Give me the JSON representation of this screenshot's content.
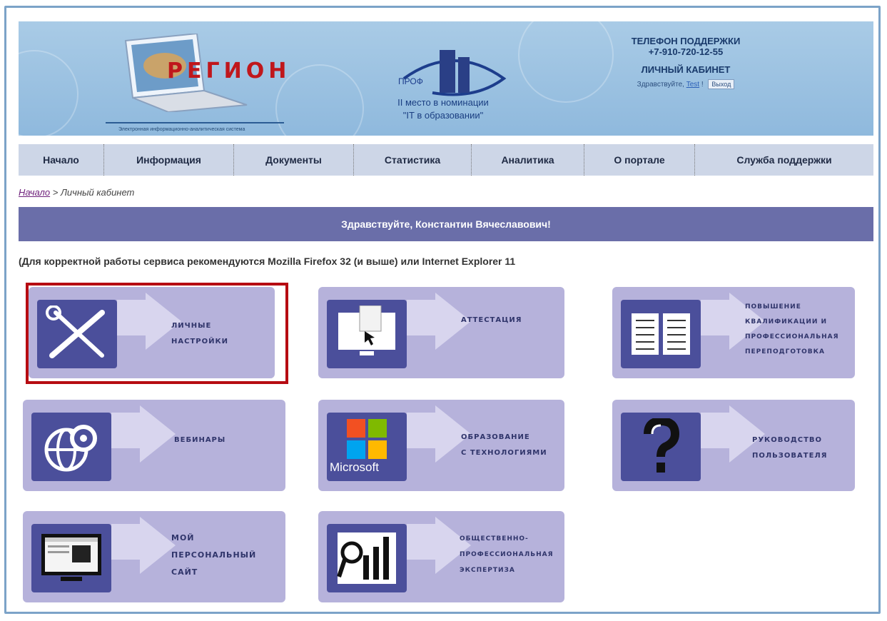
{
  "header": {
    "logo_text": "РЕГИОН",
    "logo_subtitle": "Электронная информационно-аналитическая система",
    "prof_label": "ПРОФ",
    "prof_rank": "II место в номинации",
    "prof_nomination": "\"IT в образовании\"",
    "support_label": "ТЕЛЕФОН ПОДДЕРЖКИ",
    "support_phone": "+7-910-720-12-55",
    "cabinet_label": "ЛИЧНЫЙ КАБИНЕТ",
    "greeting_prefix": "Здравствуйте,",
    "user_link": "Test",
    "greeting_suffix": "!",
    "logout_button": "Выход"
  },
  "nav": {
    "items": [
      {
        "label": "Начало"
      },
      {
        "label": "Информация"
      },
      {
        "label": "Документы"
      },
      {
        "label": "Статистика"
      },
      {
        "label": "Аналитика"
      },
      {
        "label": "О портале"
      },
      {
        "label": "Служба поддержки"
      }
    ]
  },
  "breadcrumb": {
    "home": "Начало",
    "separator": " > ",
    "current": "Личный кабинет"
  },
  "welcome": "Здравствуйте, Константин Вячеславович!",
  "notice": "(Для корректной работы сервиса рекомендуются Mozilla Firefox 32 (и выше) или Internet Explorer 11",
  "tiles": [
    {
      "label_lines": [
        "ЛИЧНЫЕ",
        "НАСТРОЙКИ"
      ],
      "icon": "tools-icon",
      "selected": true
    },
    {
      "label_lines": [
        "АТТЕСТАЦИЯ"
      ],
      "icon": "monitor-cursor-icon"
    },
    {
      "label_lines": [
        "ПОВЫШЕНИЕ",
        "КВАЛИФИКАЦИИ И",
        "ПРОФЕССИОНАЛЬНАЯ",
        "ПЕРЕПОДГОТОВКА"
      ],
      "icon": "book-icon"
    },
    {
      "label_lines": [
        "ВЕБИНАРЫ"
      ],
      "icon": "globe-gear-icon"
    },
    {
      "label_lines": [
        "ОБРАЗОВАНИЕ",
        "С ТЕХНОЛОГИЯМИ"
      ],
      "icon": "microsoft-logo-icon",
      "brand": "Microsoft"
    },
    {
      "label_lines": [
        "РУКОВОДСТВО",
        "ПОЛЬЗОВАТЕЛЯ"
      ],
      "icon": "question-mark-icon"
    },
    {
      "label_lines": [
        "МОЙ",
        "ПЕРСОНАЛЬНЫЙ",
        "САЙТ"
      ],
      "icon": "website-monitor-icon"
    },
    {
      "label_lines": [
        "ОБЩЕСТВЕННО-",
        "ПРОФЕССИОНАЛЬНАЯ",
        "ЭКСПЕРТИЗА"
      ],
      "icon": "magnifier-chart-icon"
    }
  ],
  "colors": {
    "header_bg": "#9cc3e3",
    "nav_bg": "#cdd6e7",
    "welcome_bg": "#6a6ea9",
    "tile_bg": "#b6b2db",
    "tile_icon_bg": "#4b4f9b",
    "selected_border": "#b60c12"
  }
}
